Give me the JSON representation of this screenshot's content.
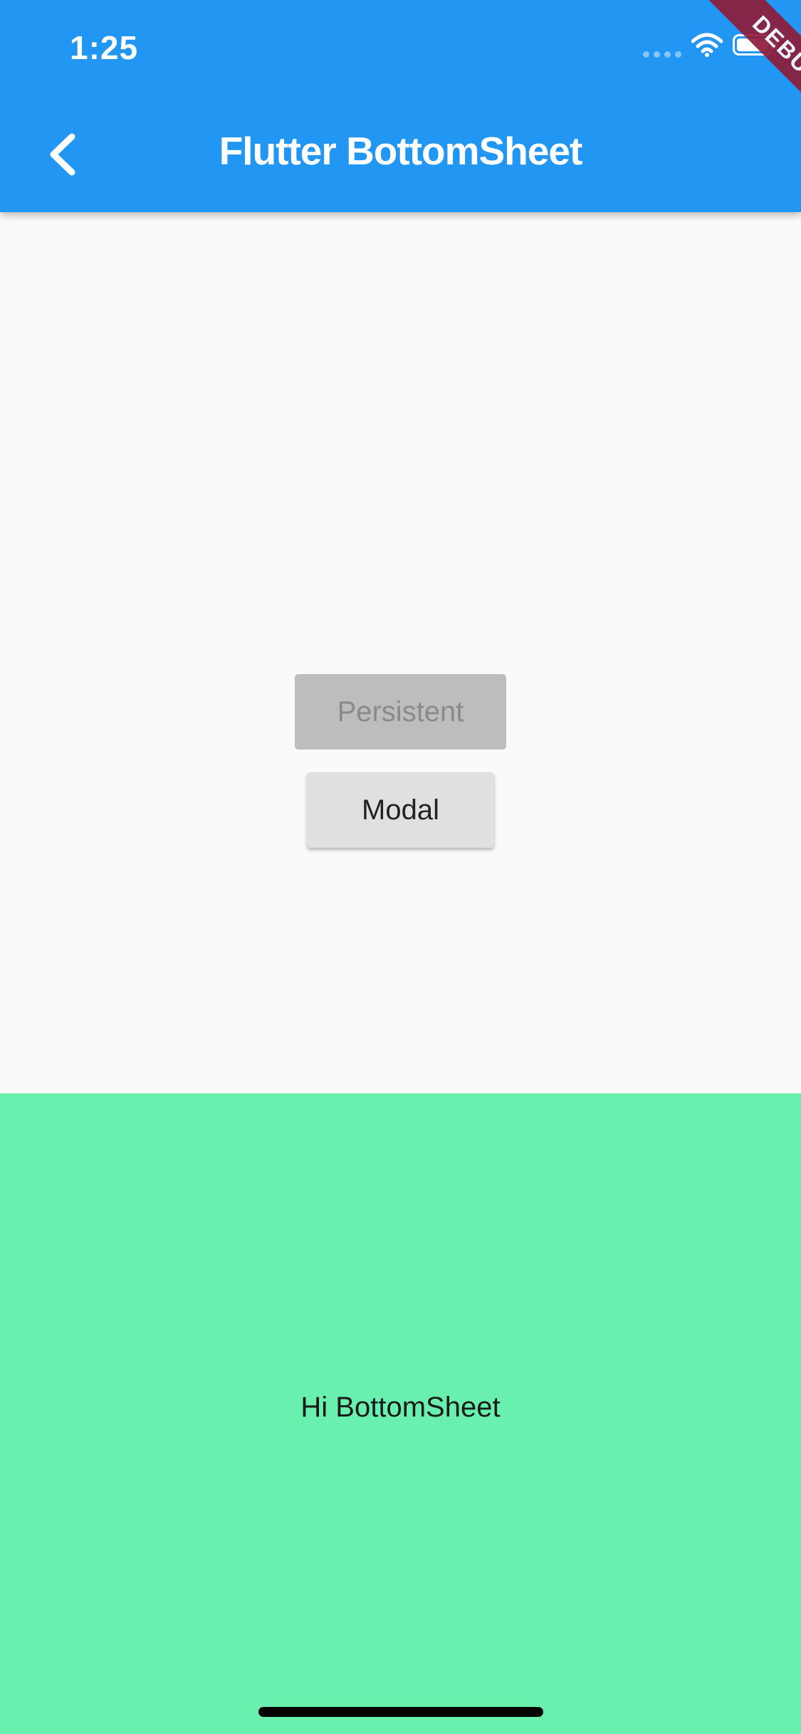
{
  "status_bar": {
    "time": "1:25",
    "icons": [
      "signal-dots-icon",
      "wifi-icon",
      "battery-icon"
    ]
  },
  "app_bar": {
    "title": "Flutter BottomSheet",
    "back_icon": "chevron-left-icon",
    "color": "#2196f3"
  },
  "debug_banner": {
    "label": "DEBUG",
    "color": "#8e1c3a"
  },
  "buttons": {
    "persistent_label": "Persistent",
    "modal_label": "Modal"
  },
  "bottom_sheet": {
    "text": "Hi BottomSheet",
    "color": "#69f0ae"
  }
}
